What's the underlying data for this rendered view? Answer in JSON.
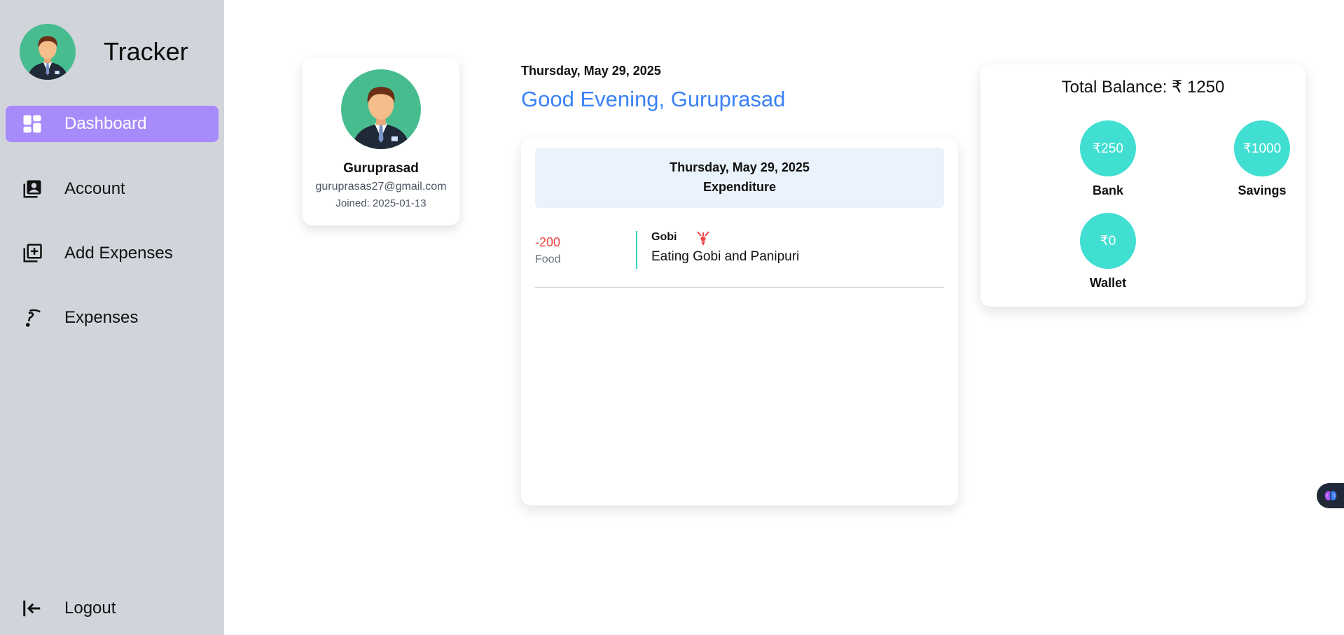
{
  "app": {
    "title": "Tracker"
  },
  "sidebar": {
    "items": [
      {
        "label": "Dashboard",
        "icon": "dashboard-icon",
        "active": true
      },
      {
        "label": "Account",
        "icon": "account-icon"
      },
      {
        "label": "Add Expenses",
        "icon": "add-expense-icon"
      },
      {
        "label": "Expenses",
        "icon": "expenses-icon"
      }
    ],
    "logout_label": "Logout"
  },
  "profile": {
    "name": "Guruprasad",
    "email": "guruprasas27@gmail.com",
    "joined": "Joined: 2025-01-13"
  },
  "header": {
    "date": "Thursday, May 29, 2025",
    "greeting": "Good Evening, Guruprasad"
  },
  "expenditure": {
    "date": "Thursday, May 29, 2025",
    "title": "Expenditure",
    "items": [
      {
        "amount": "-200",
        "category": "Food",
        "name": "Gobi",
        "description": "Eating Gobi and Panipuri"
      }
    ]
  },
  "balance": {
    "title": "Total Balance: ₹ 1250",
    "accounts": [
      {
        "label": "Bank",
        "amount": "₹250"
      },
      {
        "label": "Savings",
        "amount": "₹1000"
      },
      {
        "label": "Wallet",
        "amount": "₹0"
      }
    ]
  },
  "colors": {
    "sidebar_bg": "#d1d5db",
    "active_nav": "#a78bfa",
    "greeting": "#3b82f6",
    "account_circle": "#40dfd2",
    "negative_amount": "#ef4444"
  }
}
